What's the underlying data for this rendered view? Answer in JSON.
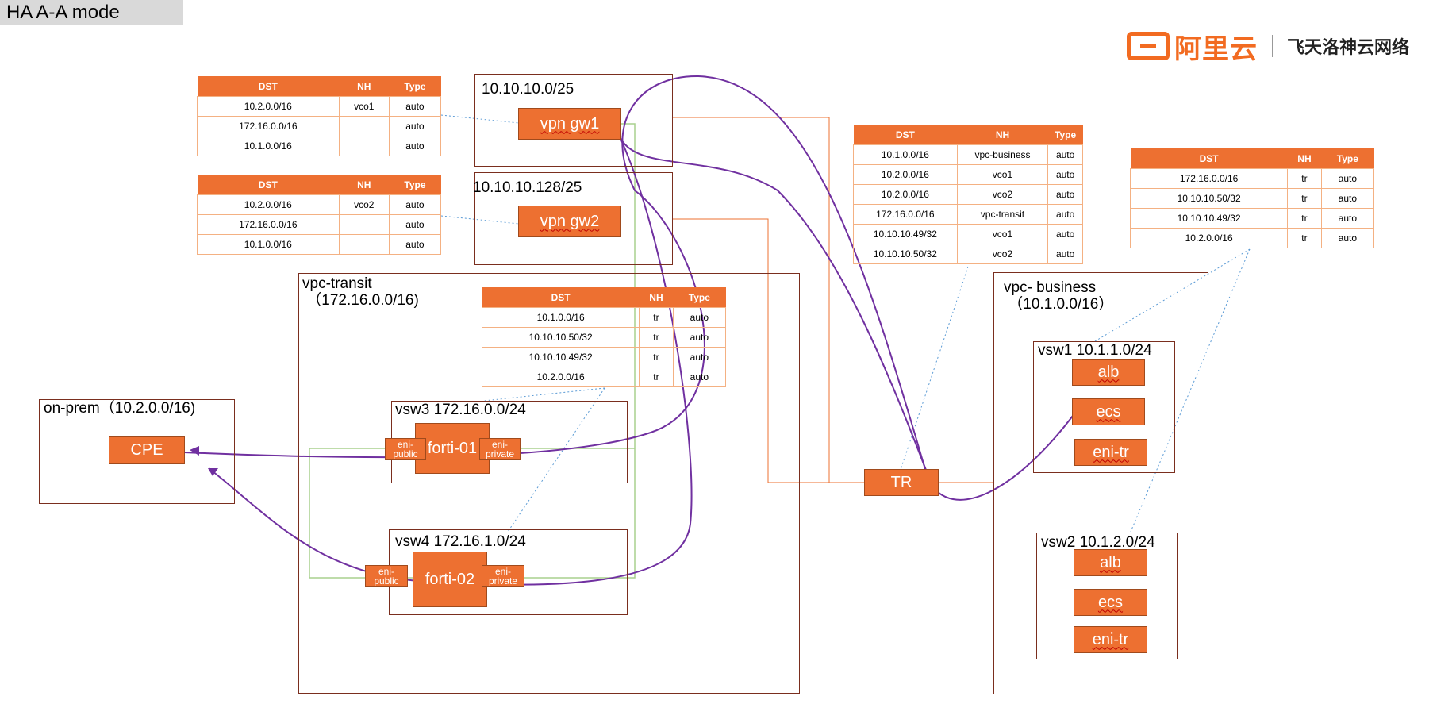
{
  "title": "HA A-A mode",
  "logo": {
    "brand": "阿里云",
    "sub": "飞天洛神云网络",
    "accent": "#f26b21"
  },
  "colors": {
    "orange": "#ed7031",
    "route_line": "#ed7031",
    "flow": "#7030a0",
    "green": "#a9d18e",
    "dotted": "#5b9bd5"
  },
  "table_headers": [
    "DST",
    "NH",
    "Type"
  ],
  "tables": {
    "vgw1": [
      [
        "10.2.0.0/16",
        "vco1",
        "auto"
      ],
      [
        "172.16.0.0/16",
        "",
        "auto"
      ],
      [
        "10.1.0.0/16",
        "",
        "auto"
      ]
    ],
    "vgw2": [
      [
        "10.2.0.0/16",
        "vco2",
        "auto"
      ],
      [
        "172.16.0.0/16",
        "",
        "auto"
      ],
      [
        "10.1.0.0/16",
        "",
        "auto"
      ]
    ],
    "transit": [
      [
        "10.1.0.0/16",
        "tr",
        "auto"
      ],
      [
        "10.10.10.50/32",
        "tr",
        "auto"
      ],
      [
        "10.10.10.49/32",
        "tr",
        "auto"
      ],
      [
        "10.2.0.0/16",
        "tr",
        "auto"
      ]
    ],
    "tr": [
      [
        "10.1.0.0/16",
        "vpc-business",
        "auto"
      ],
      [
        "10.2.0.0/16",
        "vco1",
        "auto"
      ],
      [
        "10.2.0.0/16",
        "vco2",
        "auto"
      ],
      [
        "172.16.0.0/16",
        "vpc-transit",
        "auto"
      ],
      [
        "10.10.10.49/32",
        "vco1",
        "auto"
      ],
      [
        "10.10.10.50/32",
        "vco2",
        "auto"
      ]
    ],
    "business": [
      [
        "172.16.0.0/16",
        "tr",
        "auto"
      ],
      [
        "10.10.10.50/32",
        "tr",
        "auto"
      ],
      [
        "10.10.10.49/32",
        "tr",
        "auto"
      ],
      [
        "10.2.0.0/16",
        "tr",
        "auto"
      ]
    ]
  },
  "labels": {
    "gw1_cidr": "10.10.10.0/25",
    "gw2_cidr": "10.10.10.128/25",
    "vpn_gw1": "vpn gw1",
    "vpn_gw2": "vpn gw2",
    "vpc_transit": "vpc-transit\n （172.16.0.0/16)",
    "onprem": "on-prem（10.2.0.0/16)",
    "cpe": "CPE",
    "vsw3": "vsw3 172.16.0.0/24",
    "vsw4": "vsw4 172.16.1.0/24",
    "forti1": "forti-01",
    "forti2": "forti-02",
    "eni_public": "eni-\npublic",
    "eni_private": "eni-\nprivate",
    "tr": "TR",
    "vpc_business": "vpc- business\n （10.1.0.0/16）",
    "vsw1": "vsw1 10.1.1.0/24",
    "vsw2": "vsw2 10.1.2.0/24",
    "alb": "alb",
    "ecs": "ecs",
    "eni_tr": "eni-tr"
  }
}
